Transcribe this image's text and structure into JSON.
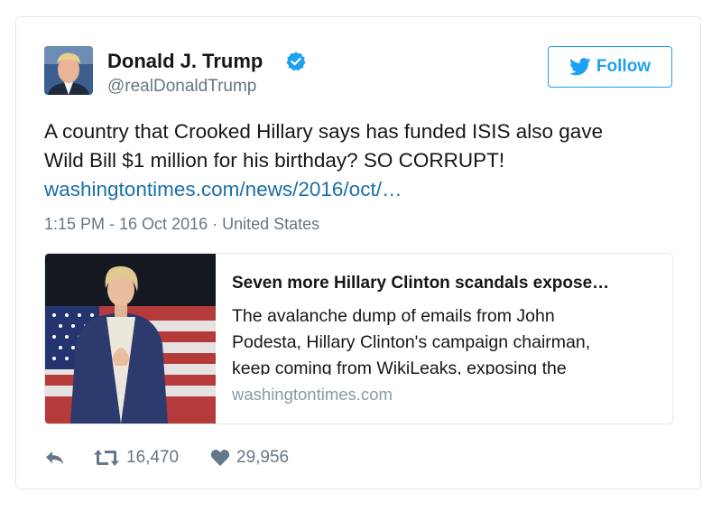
{
  "author": {
    "name": "Donald J. Trump",
    "handle": "@realDonaldTrump"
  },
  "follow_button": {
    "label": "Follow"
  },
  "tweet": {
    "text_lines": [
      "A country that Crooked Hillary says has funded ISIS also gave",
      "Wild Bill $1 million for his birthday? SO CORRUPT!"
    ],
    "link": "washingtontimes.com/news/2016/oct/…",
    "timestamp": "1:15 PM - 16 Oct 2016 · United States"
  },
  "link_card": {
    "title": "Seven more Hillary Clinton scandals expose…",
    "description_lines": [
      "The avalanche dump of emails from John",
      "Podesta, Hillary Clinton's campaign chairman,",
      "keep coming from WikiLeaks, exposing the"
    ],
    "domain": "washingtontimes.com"
  },
  "actions": {
    "retweet_count": "16,470",
    "like_count": "29,956"
  },
  "icons": {
    "verified": "verified-badge-icon",
    "twitter_bird": "twitter-bird-icon",
    "reply": "reply-icon",
    "retweet": "retweet-icon",
    "like": "heart-icon"
  },
  "colors": {
    "twitter_blue": "#1da1f2",
    "link_blue": "#1b6fa8",
    "secondary_text": "#657786",
    "border": "#e1e8ed"
  }
}
